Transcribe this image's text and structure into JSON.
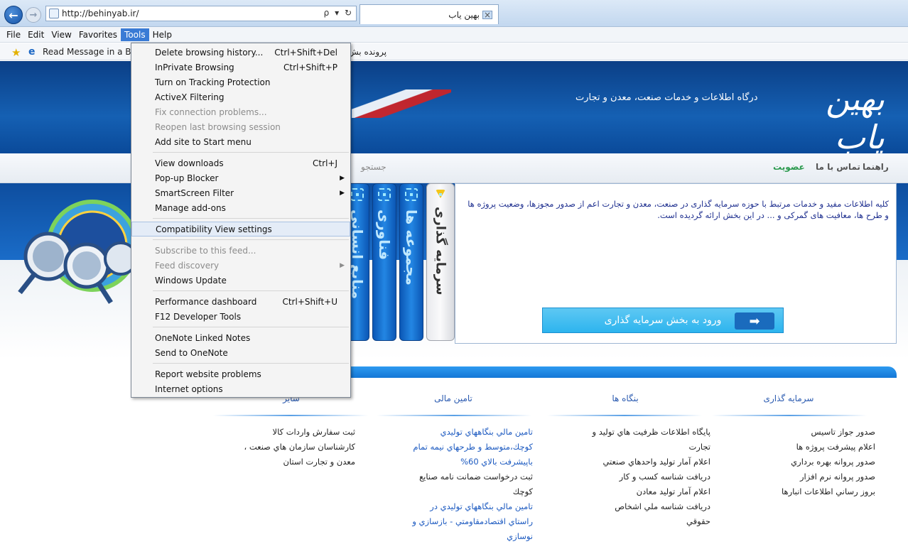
{
  "browser": {
    "url": "http://behinyab.ir/",
    "address_tools": "ρ ▾ ↻",
    "tab_title": "بهین یاب",
    "tab_close": "×",
    "menubar": [
      "File",
      "Edit",
      "View",
      "Favorites",
      "Tools",
      "Help"
    ],
    "favorites": {
      "item1": "Read Message in a Bottl",
      "item2": "پرونده بش"
    }
  },
  "tools_menu": {
    "items": [
      {
        "label": "Delete browsing history...",
        "shortcut": "Ctrl+Shift+Del",
        "state": "enabled"
      },
      {
        "label": "InPrivate Browsing",
        "shortcut": "Ctrl+Shift+P",
        "state": "enabled"
      },
      {
        "label": "Turn on Tracking Protection",
        "shortcut": "",
        "state": "enabled"
      },
      {
        "label": "ActiveX Filtering",
        "shortcut": "",
        "state": "enabled"
      },
      {
        "label": "Fix connection problems...",
        "shortcut": "",
        "state": "disabled"
      },
      {
        "label": "Reopen last browsing session",
        "shortcut": "",
        "state": "disabled"
      },
      {
        "label": "Add site to Start menu",
        "shortcut": "",
        "state": "enabled"
      },
      {
        "label": "View downloads",
        "shortcut": "Ctrl+J",
        "state": "enabled"
      },
      {
        "label": "Pop-up Blocker",
        "shortcut": "",
        "state": "enabled"
      },
      {
        "label": "SmartScreen Filter",
        "shortcut": "",
        "state": "enabled"
      },
      {
        "label": "Manage add-ons",
        "shortcut": "",
        "state": "enabled"
      },
      {
        "label": "Compatibility View settings",
        "shortcut": "",
        "state": "highlighted"
      },
      {
        "label": "Subscribe to this feed...",
        "shortcut": "",
        "state": "disabled"
      },
      {
        "label": "Feed discovery",
        "shortcut": "",
        "state": "disabled"
      },
      {
        "label": "Windows Update",
        "shortcut": "",
        "state": "enabled"
      },
      {
        "label": "Performance dashboard",
        "shortcut": "Ctrl+Shift+U",
        "state": "enabled"
      },
      {
        "label": "F12 Developer Tools",
        "shortcut": "",
        "state": "enabled"
      },
      {
        "label": "OneNote Linked Notes",
        "shortcut": "",
        "state": "enabled"
      },
      {
        "label": "Send to OneNote",
        "shortcut": "",
        "state": "enabled"
      },
      {
        "label": "Report website problems",
        "shortcut": "",
        "state": "enabled"
      },
      {
        "label": "Internet options",
        "shortcut": "",
        "state": "enabled"
      }
    ],
    "submenu_arrow": "▶"
  },
  "site": {
    "tagline": "درگاه اطلاعات و خدمات صنعت، معدن و تجارت",
    "logo_text": "بهین یاب",
    "nav": {
      "help": "راهنما",
      "contact": "تماس با ما",
      "membership": "عضویت",
      "search": "جستجو"
    },
    "vertical_tabs": {
      "investment": "سرمایه گذاری",
      "collections": "مجموعه ها",
      "technology": "فناوری",
      "resources": "منابع انسانی"
    },
    "content_text": "کلیه اطلاعات مفید و خدمات مرتبط با حوزه سرمایه گذاری در صنعت، معدن و تجارت اعم از صدور مجوزها، وضعیت پروژه ها و طرح ها، معافیت های گمرکی و ... در این بخش ارائه گردیده است.",
    "enter_button": "ورود به بخش سرمایه گذاری",
    "enter_arrow": "➡",
    "columns": [
      {
        "title": "سرمایه گذاری",
        "items": [
          {
            "text": "صدور جواز تاسیس",
            "link": false
          },
          {
            "text": "اعلام پیشرفت پروژه ها",
            "link": false
          },
          {
            "text": "صدور پروانه بهره برداري",
            "link": false
          },
          {
            "text": "صدور پروانه نرم افزار",
            "link": false
          },
          {
            "text": "بروز رساني اطلاعات انبارها",
            "link": false
          }
        ]
      },
      {
        "title": "بنگاه ها",
        "items": [
          {
            "text": "پايگاه اطلاعات ظرفيت هاي توليد و",
            "link": false
          },
          {
            "text": "تجارت",
            "link": false
          },
          {
            "text": "اعلام آمار توليد واحدهاي صنعتي",
            "link": false
          },
          {
            "text": "دريافت شناسه كسب و كار",
            "link": false
          },
          {
            "text": "اعلام آمار توليد معادن",
            "link": false
          },
          {
            "text": "دريافت شناسه ملي اشخاص",
            "link": false
          },
          {
            "text": "حقوقي",
            "link": false
          }
        ]
      },
      {
        "title": "تامین مالی",
        "items": [
          {
            "text": "تامين مالي بنگاههاي توليدي",
            "link": true
          },
          {
            "text": "كوچك،متوسط و طرحهاي نيمه تمام",
            "link": true
          },
          {
            "text": "باپيشرفت بالاي 60%",
            "link": true
          },
          {
            "text": "ثبت درخواست ضمانت نامه صنايع",
            "link": false
          },
          {
            "text": "كوچك",
            "link": false
          },
          {
            "text": "تامين مالي بنگاههاي توليدي در",
            "link": true
          },
          {
            "text": "راستاي اقتصادمقاومتي - بازسازي و",
            "link": true
          },
          {
            "text": "نوسازي",
            "link": true
          }
        ]
      },
      {
        "title": "سایر",
        "items": [
          {
            "text": "ثبت سفارش واردات كالا",
            "link": false
          },
          {
            "text": "كارشناسان سازمان هاي صنعت ،",
            "link": false
          },
          {
            "text": "معدن و تجارت استان",
            "link": false
          }
        ]
      }
    ]
  },
  "colors": {
    "header_blue": "#0b3f86",
    "accent_green": "#2b9a4e",
    "link_blue": "#1b59c0",
    "menu_highlight": "#3a7bd5"
  }
}
